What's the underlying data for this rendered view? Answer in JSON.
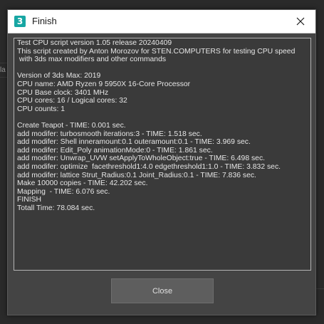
{
  "window": {
    "title": "Finish",
    "app_icon_glyph": "3",
    "app_icon_name": "3ds-max-icon",
    "close_icon_name": "close-icon"
  },
  "background": {
    "edge_text": "lar"
  },
  "output": {
    "lines": [
      "Test CPU script version 1.05 release 20240409",
      "This script created by Anton Morozov for STEN.COMPUTERS for testing CPU speed",
      " with 3ds max modifiers and other commands",
      "",
      "Version of 3ds Max: 2019",
      "CPU name: AMD Ryzen 9 5950X 16-Core Processor",
      "CPU Base clock: 3401 MHz",
      "CPU cores: 16 / Logical cores: 32",
      "CPU counts: 1",
      "",
      "Create Teapot - TIME: 0.001 sec.",
      "add modifer: turbosmooth iterations:3 - TIME: 1.518 sec.",
      "add modifer: Shell inneramount:0.1 outeramount:0.1 - TIME: 3.969 sec.",
      "add modifer: Edit_Poly animationMode:0 - TIME: 1.861 sec.",
      "add modifer: Unwrap_UVW setApplyToWholeObject:true - TIME: 6.498 sec.",
      "add modifer: optimize  facethreshold1:4.0 edgethreshold1:1.0 - TIME: 3.832 sec.",
      "add modifer: lattice Strut_Radius:0.1 Joint_Radius:0.1 - TIME: 7.836 sec.",
      "Make 10000 copies - TIME: 42.202 sec.",
      "Mapping  - TIME: 6.076 sec.",
      "FINISH",
      "Totall Time: 78.084 sec."
    ]
  },
  "buttons": {
    "close_label": "Close"
  },
  "colors": {
    "titlebar": "#ffffff",
    "dialog_bg": "#444444",
    "output_bg": "#3a3a3a",
    "output_text": "#e6e6e6",
    "accent_icon": "#17a6a3",
    "button_bg": "#5e5e5e"
  }
}
